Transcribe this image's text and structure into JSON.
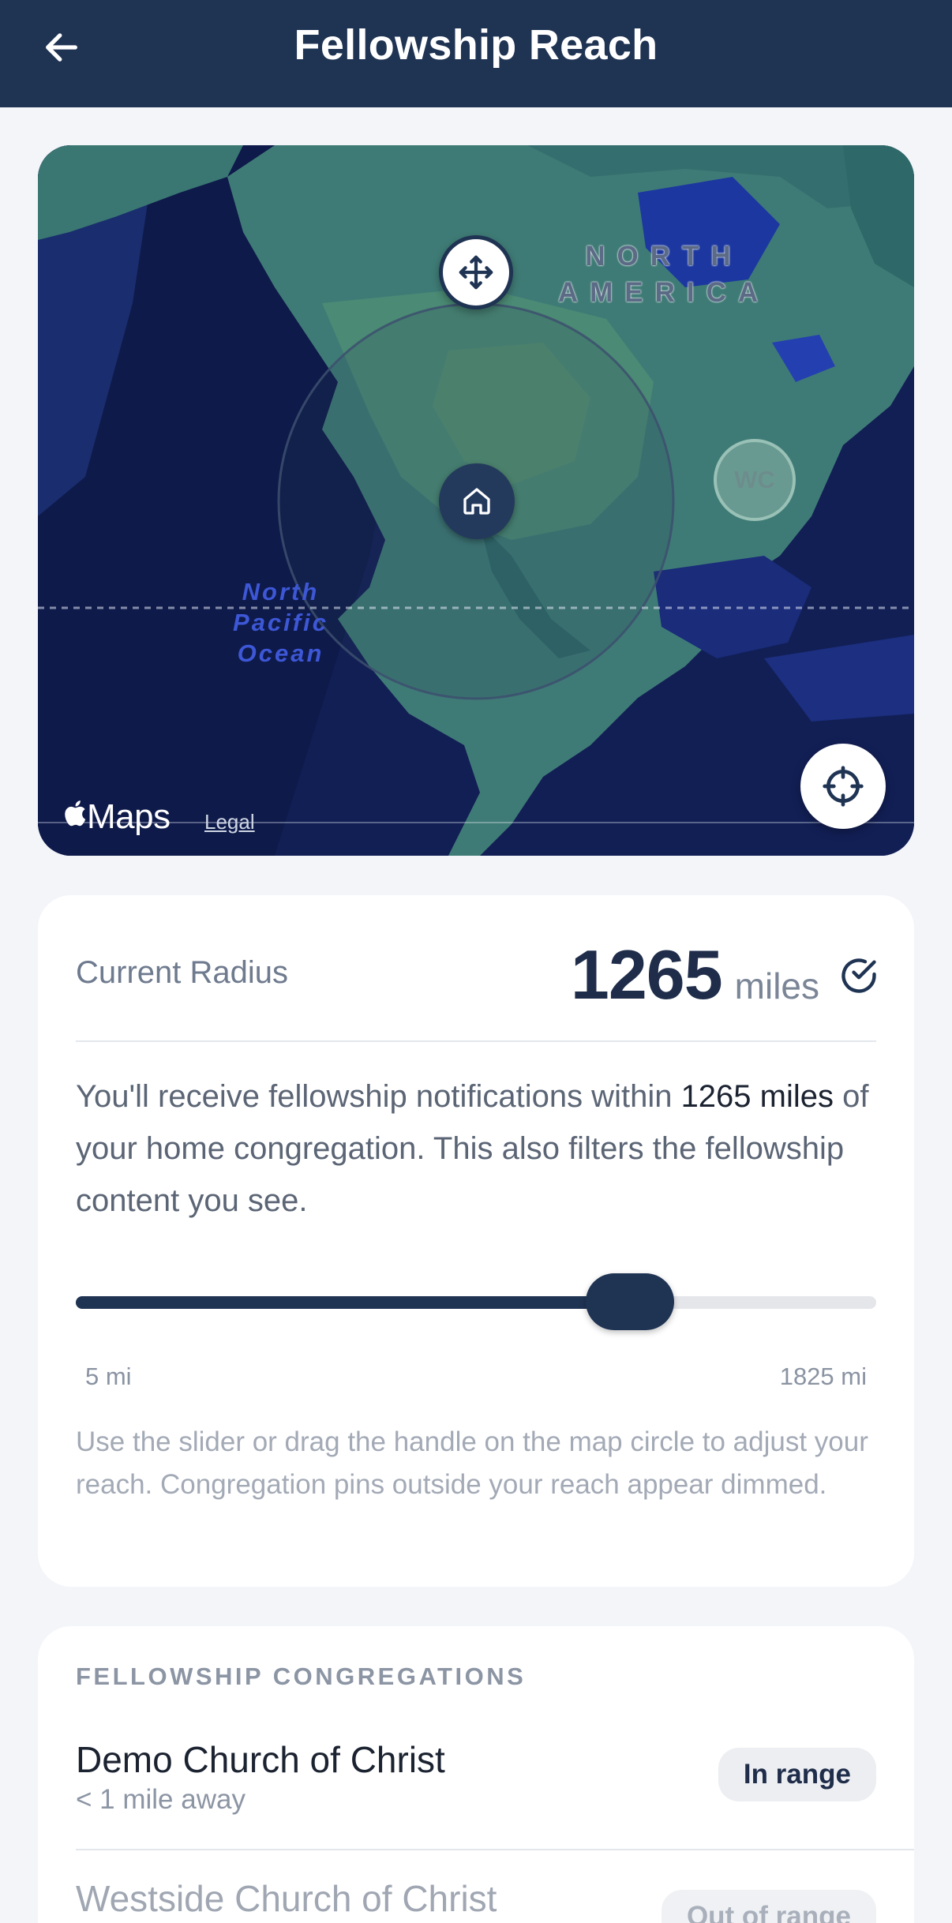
{
  "header": {
    "title": "Fellowship Reach",
    "back_icon": "arrow-left-icon"
  },
  "map": {
    "continent_label_line1": "NORTH",
    "continent_label_line2": "AMERICA",
    "ocean_label_line1": "North",
    "ocean_label_line2": "Pacific",
    "ocean_label_line3": "Ocean",
    "home_pin_icon": "home-icon",
    "move_handle_icon": "move-arrows-icon",
    "other_pin_label": "WC",
    "locate_icon": "crosshair-icon",
    "brand": "Maps",
    "legal": "Legal"
  },
  "radius": {
    "label": "Current Radius",
    "value": "1265",
    "unit": "miles",
    "desc_prefix": "You'll receive fellowship notifications within ",
    "desc_highlight": "1265 miles",
    "desc_suffix": " of your home congregation. This also filters the fellowship content you see.",
    "slider_min_label": "5 mi",
    "slider_max_label": "1825 mi",
    "slider_min": 5,
    "slider_max": 1825,
    "slider_value": 1265,
    "hint": "Use the slider or drag the handle on the map circle to adjust your reach. Congregation pins outside your reach appear dimmed."
  },
  "congregations": {
    "title": "FELLOWSHIP CONGREGATIONS",
    "items": [
      {
        "name": "Demo Church of Christ",
        "distance": "< 1 mile away",
        "badge": "In range"
      },
      {
        "name": "Westside Church of Christ",
        "distance": "",
        "badge": "Out of range"
      }
    ]
  },
  "colors": {
    "primary": "#1f3353",
    "background": "#f3f5f9",
    "map_water": "#0f1d4e",
    "map_land": "#3e7a74"
  }
}
